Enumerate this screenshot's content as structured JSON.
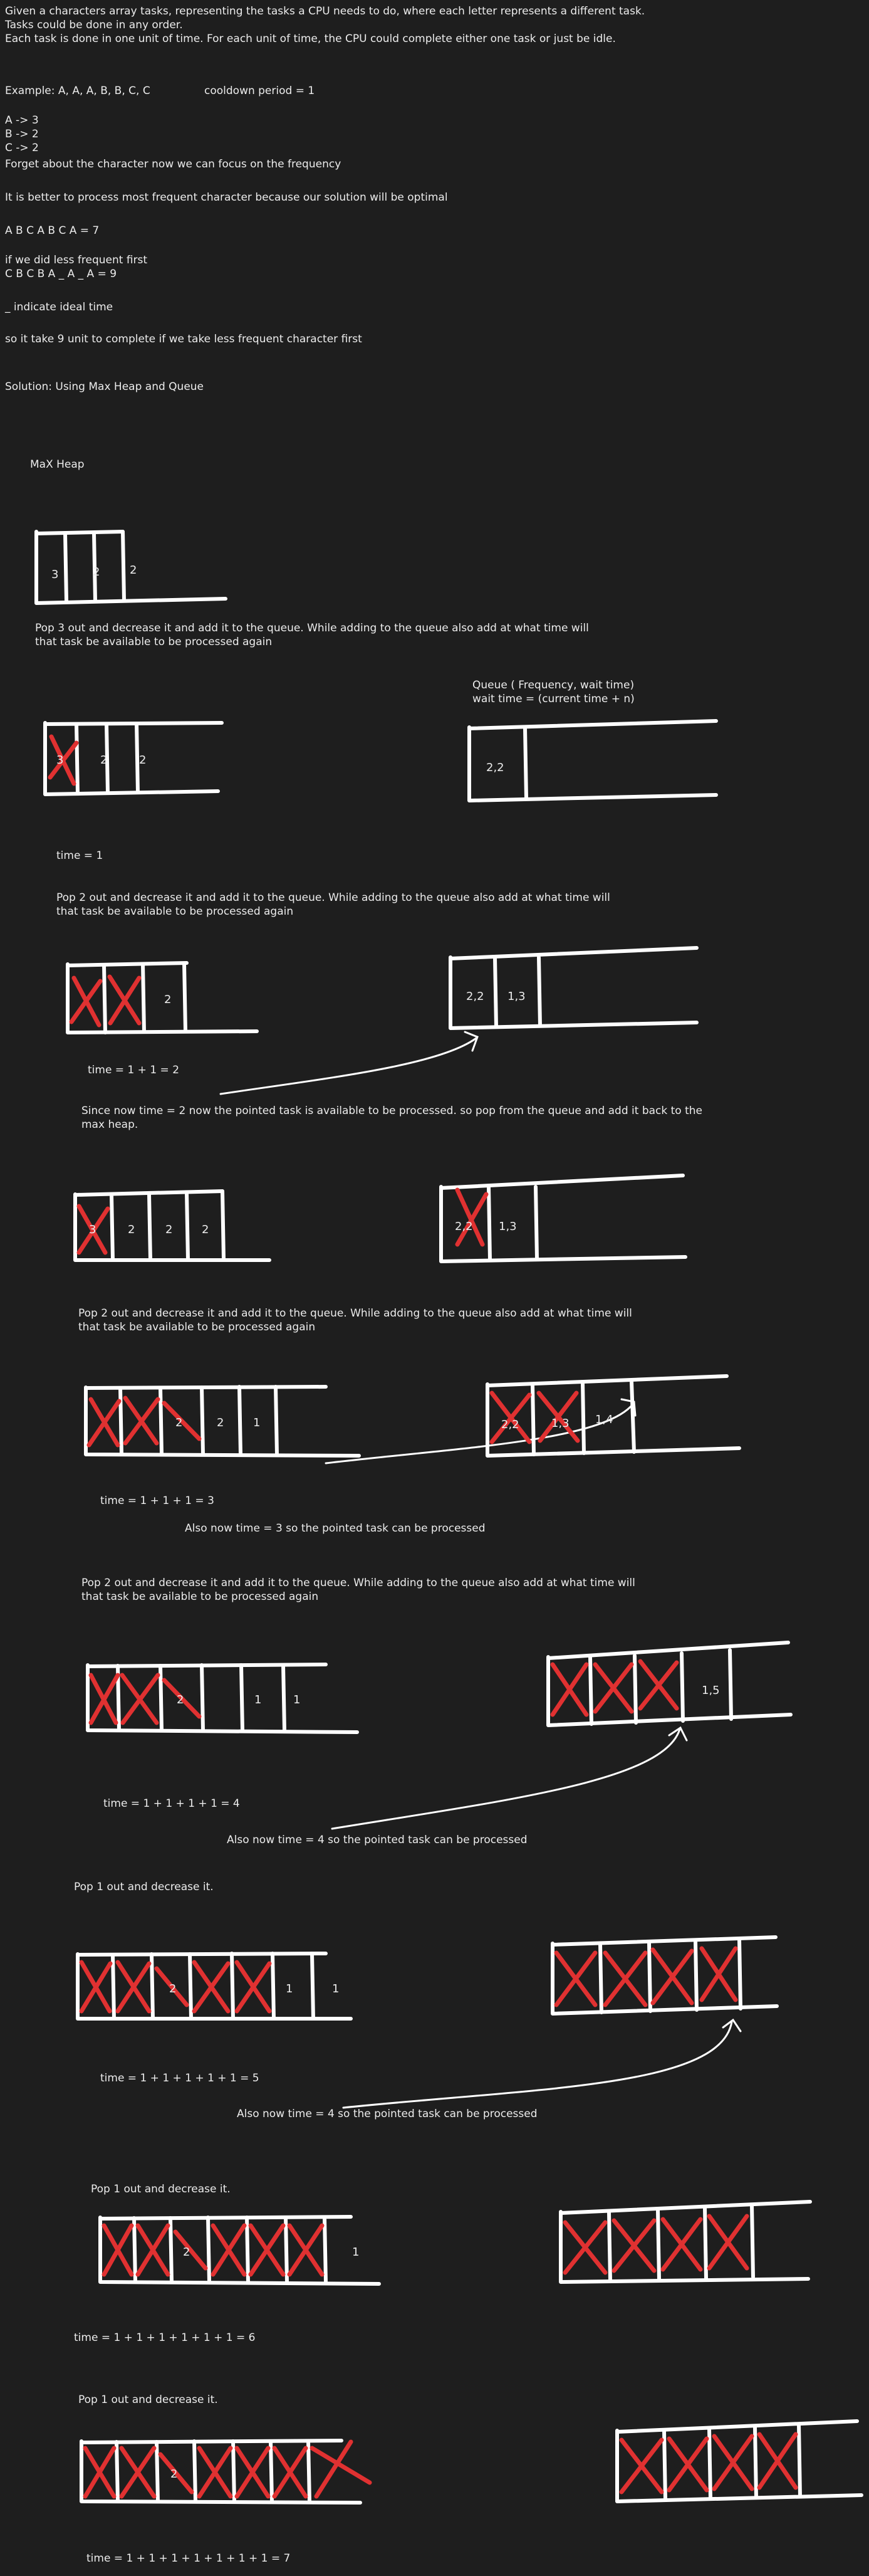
{
  "intro": {
    "line1": "Given a characters array tasks, representing the tasks a CPU needs to do, where each letter represents a different task.",
    "line2": "Tasks could be done in any order.",
    "line3": "Each task is done in one unit of time. For each unit of time, the CPU could complete either one task or just be idle."
  },
  "example": {
    "line": "Example: A, A, A, B, B, C, C",
    "cooldown": "cooldown period = 1",
    "freq_a": "A -> 3",
    "freq_b": "B -> 2",
    "freq_c": "C -> 2",
    "forget": "Forget about the character now we can focus on the frequency",
    "better": "It is better to process most frequent character because our solution will be optimal",
    "seq_optimal": "A B C A B C A = 7",
    "if_less": "if we did less frequent first",
    "seq_less": "C B C B A _ A _ A = 9",
    "idle_note": "_ indicate ideal time",
    "nine_units": "so it take 9 unit to complete if we take less frequent character first",
    "solution": "Solution: Using Max Heap and Queue"
  },
  "maxheap_label": "MaX Heap",
  "queue_label": {
    "line1": "Queue ( Frequency, wait time)",
    "line2": "wait time = (current time + n)"
  },
  "steps": {
    "s1_line1": "Pop 3 out and decrease it and add it to the queue. While adding to the queue also add at what time will",
    "s1_line2": "that task be available to be processed again",
    "s2_line1": "Pop 2 out and decrease it and add it to the queue. While adding to the queue also add at what time will",
    "s2_line2": "that task be available to be processed again",
    "s3_line1": "Pop 2 out and decrease it and add it to the queue. While adding to the queue also add at what time will",
    "s3_line2": "that task be available to be processed again",
    "s4_line1": "Pop 2 out and decrease it and add it to the queue. While adding to the queue also add at what time will",
    "s4_line2": "that task be available to be processed again",
    "s5": "Pop 1 out and decrease it.",
    "s6": "Pop 1 out and decrease it.",
    "s7": "Pop 1 out and decrease it."
  },
  "times": {
    "t1": "time = 1",
    "t2": "time = 1 + 1 = 2",
    "t3": "time = 1 + 1 + 1 = 3",
    "t4": "time = 1 + 1 + 1 + 1 = 4",
    "t5": "time = 1 + 1 + 1 + 1 + 1 = 5",
    "t6": "time = 1 + 1 + 1 + 1 + 1 + 1 = 6",
    "t7": "time = 1 + 1 + 1 + 1 + 1 + 1 + 1 = 7"
  },
  "notes": {
    "since_line1": "Since now time = 2 now the pointed task is available to be processed. so pop from the queue and add it back to the",
    "since_line2": "max heap.",
    "also3": "Also now time = 3 so the pointed task can be processed",
    "also4": "Also now time = 4 so the pointed task can be processed",
    "also4b": "Also now time = 4 so the pointed task can be processed"
  },
  "cells": {
    "three": "3",
    "two": "2",
    "one": "1",
    "q22": "2,2",
    "q13": "1,3",
    "q14": "1,4",
    "q15": "1,5"
  },
  "colors": {
    "background": "#1e1e1e",
    "stroke": "#ffffff",
    "cross": "#e03131",
    "text": "#ececec"
  }
}
